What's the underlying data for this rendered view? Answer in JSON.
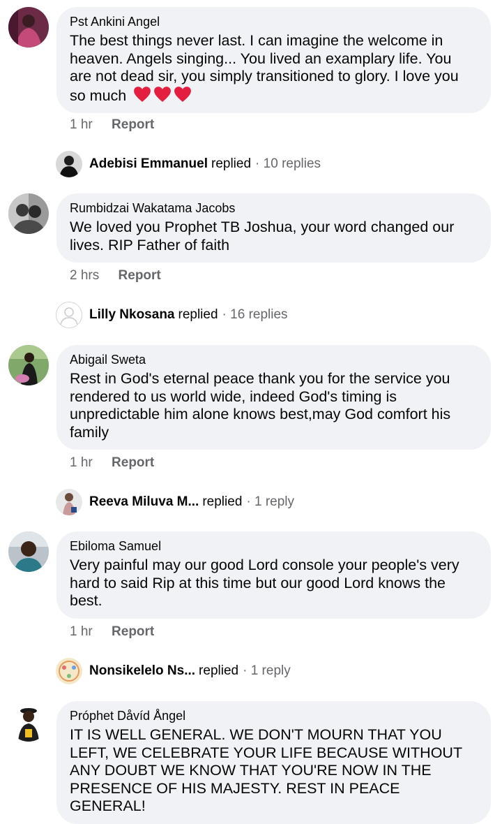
{
  "comments": [
    {
      "author": "Pst Ankini Angel",
      "text": "The best things never last. I can imagine the welcome in heaven. Angels singing... You lived an examplary life. You are not dead sir, you simply transitioned to glory. I love you so much",
      "time": "1 hr",
      "report": "Report",
      "reply": {
        "name": "Adebisi Emmanuel",
        "verb": "replied",
        "count": "· 10 replies"
      }
    },
    {
      "author": "Rumbidzai Wakatama Jacobs",
      "text": "We loved you Prophet TB Joshua, your word changed our lives. RIP Father of faith",
      "time": "2 hrs",
      "report": "Report",
      "reply": {
        "name": "Lilly Nkosana",
        "verb": "replied",
        "count": "· 16 replies"
      }
    },
    {
      "author": "Abigail Sweta",
      "text": "Rest in God's eternal peace thank you for the service you rendered to us world wide, indeed God's timing is unpredictable him alone knows best,may God comfort his family",
      "time": "1 hr",
      "report": "Report",
      "reply": {
        "name": "Reeva Miluva M...",
        "verb": "replied",
        "count": "· 1 reply"
      }
    },
    {
      "author": "Ebiloma Samuel",
      "text": "Very painful may our good Lord console your people's very hard to said Rip at this time but our good Lord knows the best.",
      "time": "1 hr",
      "report": "Report",
      "reply": {
        "name": "Nonsikelelo Ns...",
        "verb": "replied",
        "count": "· 1 reply"
      }
    },
    {
      "author": "Próphet Dåvíd Ångel",
      "text": "IT IS WELL GENERAL. WE DON'T MOURN THAT YOU LEFT, WE CELEBRATE YOUR LIFE BECAUSE WITHOUT ANY DOUBT WE KNOW THAT YOU'RE NOW IN THE PRESENCE OF HIS MAJESTY. REST IN PEACE GENERAL!"
    }
  ],
  "colors": {
    "bubble": "#f0f2f5",
    "secondary_text": "#65676b",
    "heart": "#e41e3f"
  },
  "icons": {
    "emoji": "red-heart-icon"
  }
}
